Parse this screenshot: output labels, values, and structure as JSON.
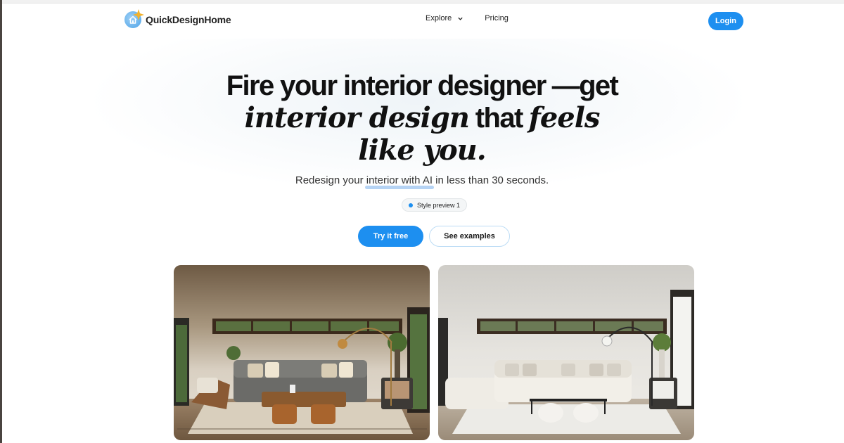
{
  "brand": {
    "name": "QuickDesignHome",
    "logo_icon": "house-icon"
  },
  "nav": {
    "explore_label": "Explore",
    "pricing_label": "Pricing",
    "login_label": "Login"
  },
  "hero": {
    "line1_a": "Fire your interior",
    "line1_highlight": "designer",
    "line1_b": "—get",
    "line2_serif": "interior design",
    "line2_sans": "that",
    "line2_serif_b": "feels",
    "line3_serif": "like you.",
    "subhead_a": "Redesign your",
    "subhead_underline": "interior with AI",
    "subhead_b": "in less than 30 seconds.",
    "style_pill_label": "Style preview 1",
    "cta_primary": "Try it free",
    "cta_secondary": "See examples"
  },
  "images": {
    "before_alt": "",
    "after_alt": ""
  },
  "colors": {
    "accent": "#1d8ff0",
    "text": "#111111"
  }
}
